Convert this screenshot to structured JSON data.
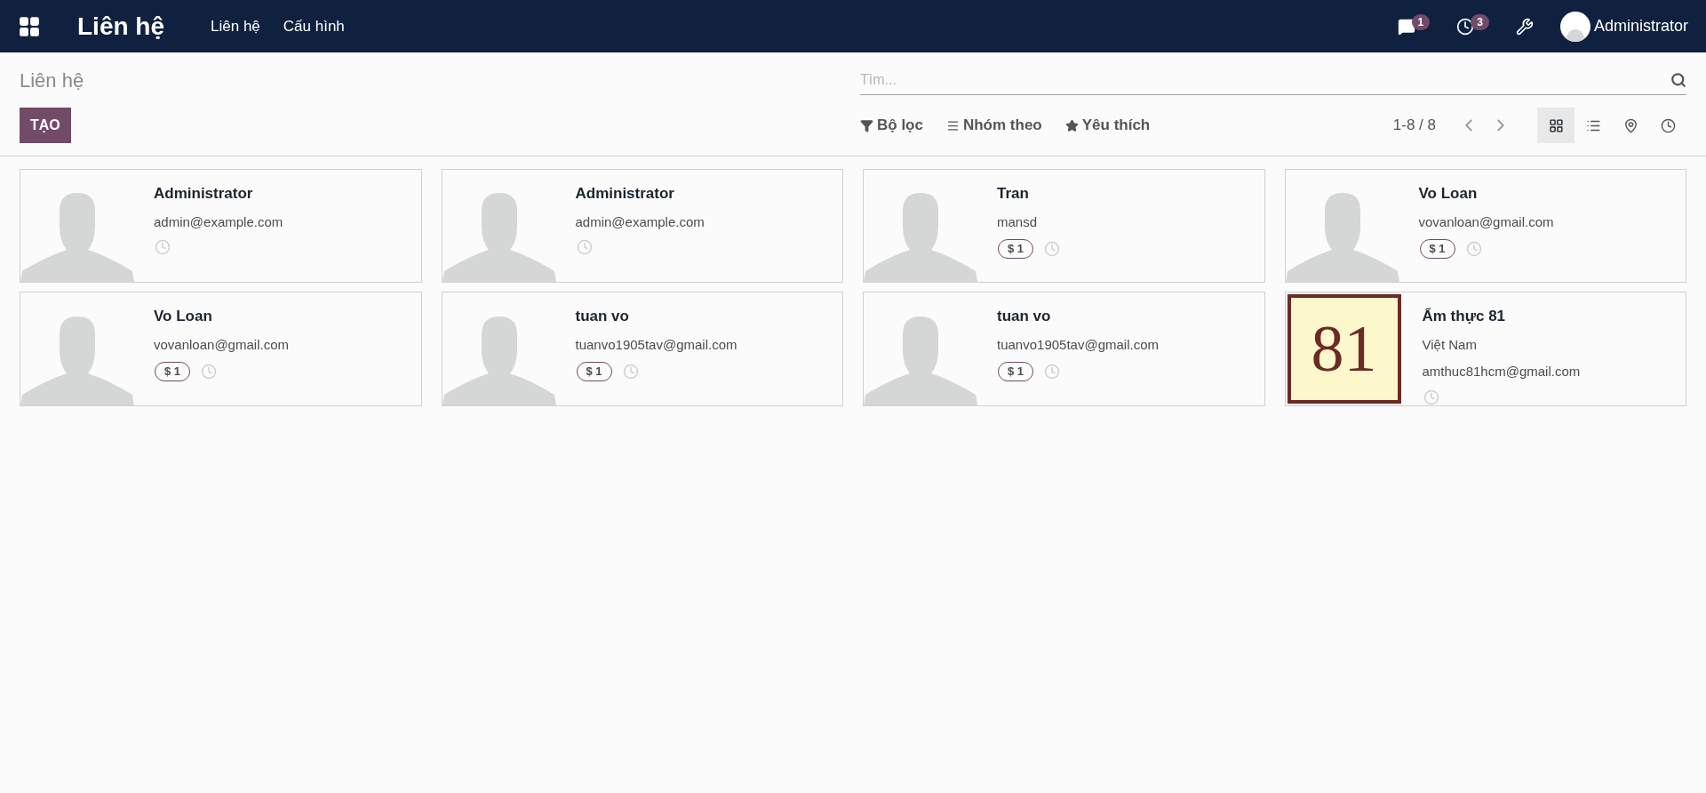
{
  "navbar": {
    "app_title": "Liên hệ",
    "menu": [
      {
        "label": "Liên hệ"
      },
      {
        "label": "Cấu hình"
      }
    ],
    "messages_count": "1",
    "activities_count": "3",
    "user": "Administrator"
  },
  "control_panel": {
    "breadcrumb": "Liên hệ",
    "create_button": "TẠO",
    "search": {
      "placeholder": "Tìm..."
    },
    "filters": [
      {
        "kind": "filter",
        "label": "Bộ lọc"
      },
      {
        "kind": "group",
        "label": "Nhóm theo"
      },
      {
        "kind": "favorite",
        "label": "Yêu thích"
      }
    ],
    "pager": "1-8 / 8",
    "views": [
      {
        "kind": "kanban",
        "selected": true
      },
      {
        "kind": "list",
        "selected": false
      },
      {
        "kind": "map",
        "selected": false
      },
      {
        "kind": "activity",
        "selected": false
      }
    ]
  },
  "cards": [
    {
      "kind": "avatar",
      "name": "Administrator",
      "lines": [
        "admin@example.com"
      ]
    },
    {
      "kind": "avatar",
      "name": "Administrator",
      "lines": [
        "admin@example.com"
      ]
    },
    {
      "kind": "avatar",
      "name": "Tran",
      "lines": [
        "mansd"
      ],
      "badge": "$ 1"
    },
    {
      "kind": "avatar",
      "name": "Vo Loan",
      "lines": [
        "vovanloan@gmail.com"
      ],
      "badge": "$ 1"
    },
    {
      "kind": "avatar",
      "name": "Vo Loan",
      "lines": [
        "vovanloan@gmail.com"
      ],
      "badge": "$ 1"
    },
    {
      "kind": "avatar",
      "name": "tuan vo",
      "lines": [
        "tuanvo1905tav@gmail.com"
      ],
      "badge": "$ 1"
    },
    {
      "kind": "avatar",
      "name": "tuan vo",
      "lines": [
        "tuanvo1905tav@gmail.com"
      ],
      "badge": "$ 1"
    },
    {
      "kind": "logo",
      "logo_text": "81",
      "name": "Ẩm thực 81",
      "lines": [
        "Việt Nam",
        "amthuc81hcm@gmail.com"
      ]
    }
  ]
}
